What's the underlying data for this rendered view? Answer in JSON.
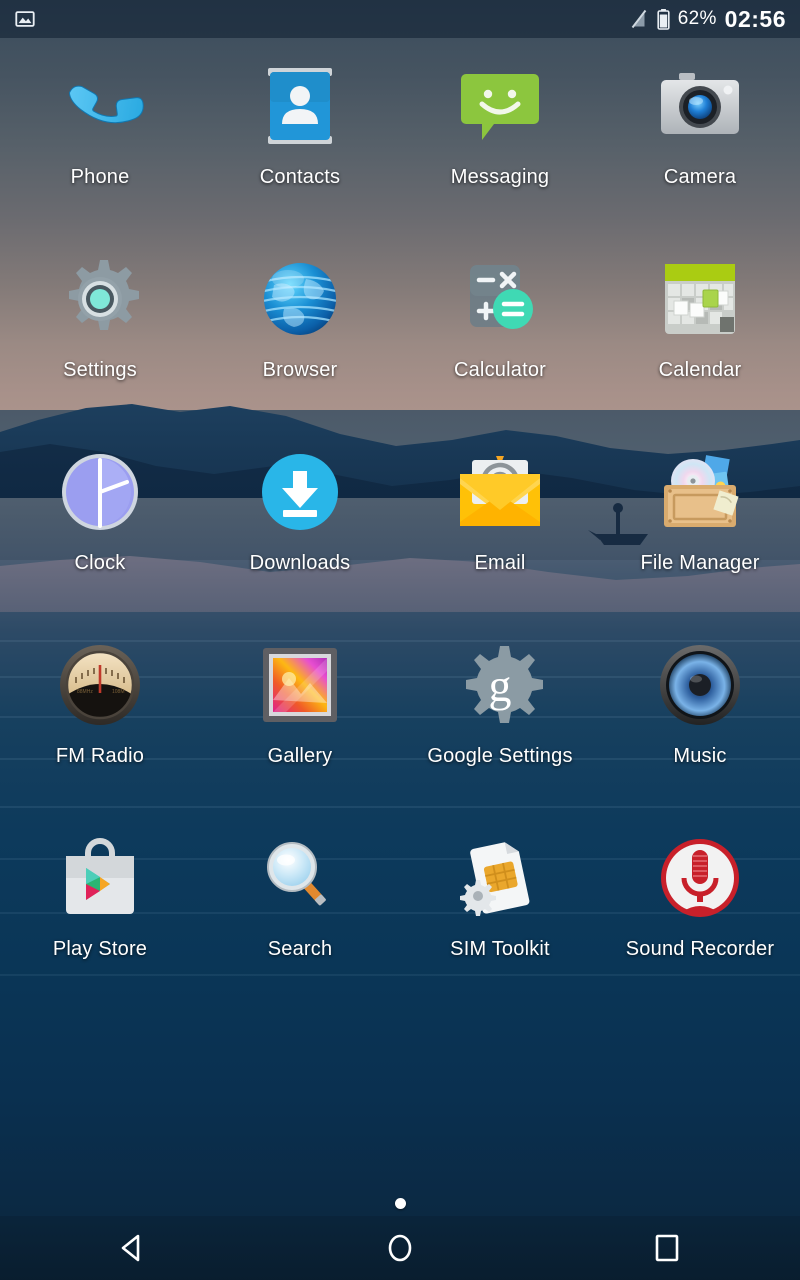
{
  "status_bar": {
    "notification_icon": "image-icon",
    "signal_icon": "no-sim-signal-icon",
    "battery_icon": "battery-icon",
    "battery_percent": "62%",
    "clock": "02:56"
  },
  "home_screen": {
    "page_indicator": {
      "total_pages": 1,
      "current_page": 1
    },
    "apps": [
      {
        "label": "Phone",
        "icon": "phone-icon"
      },
      {
        "label": "Contacts",
        "icon": "contacts-icon"
      },
      {
        "label": "Messaging",
        "icon": "messaging-icon"
      },
      {
        "label": "Camera",
        "icon": "camera-icon"
      },
      {
        "label": "Settings",
        "icon": "settings-gear-icon"
      },
      {
        "label": "Browser",
        "icon": "browser-globe-icon"
      },
      {
        "label": "Calculator",
        "icon": "calculator-icon"
      },
      {
        "label": "Calendar",
        "icon": "calendar-icon"
      },
      {
        "label": "Clock",
        "icon": "clock-icon"
      },
      {
        "label": "Downloads",
        "icon": "downloads-arrow-icon"
      },
      {
        "label": "Email",
        "icon": "email-envelope-icon"
      },
      {
        "label": "File Manager",
        "icon": "file-manager-crate-icon"
      },
      {
        "label": "FM Radio",
        "icon": "fm-radio-dial-icon"
      },
      {
        "label": "Gallery",
        "icon": "gallery-photo-icon"
      },
      {
        "label": "Google Settings",
        "icon": "google-settings-gear-icon"
      },
      {
        "label": "Music",
        "icon": "music-speaker-icon"
      },
      {
        "label": "Play Store",
        "icon": "play-store-bag-icon"
      },
      {
        "label": "Search",
        "icon": "search-magnifier-icon"
      },
      {
        "label": "SIM Toolkit",
        "icon": "sim-toolkit-icon"
      },
      {
        "label": "Sound Recorder",
        "icon": "sound-recorder-mic-icon"
      }
    ]
  },
  "nav_bar": {
    "back_label": "Back",
    "home_label": "Home",
    "recents_label": "Recent apps",
    "back_icon": "back-triangle-icon",
    "home_icon": "home-circle-icon",
    "recents_icon": "recents-square-icon"
  },
  "colors": {
    "status_text": "#ffffff",
    "label_text": "#ffffff",
    "wallpaper_sky_top": "#3a4c5c",
    "wallpaper_horizon": "#ab948c",
    "wallpaper_water_deep": "#0a3657",
    "mountain_dark": "#14324f",
    "accent_green": "#8ec63f",
    "accent_blue": "#29b6f6",
    "accent_red": "#cc2229"
  }
}
